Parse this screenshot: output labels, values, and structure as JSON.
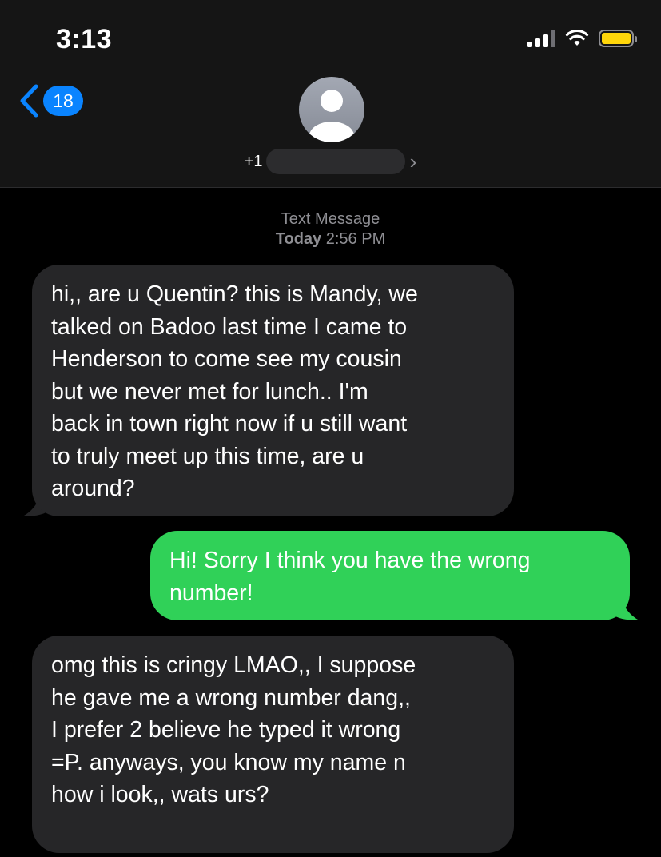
{
  "status_bar": {
    "time": "3:13",
    "battery_color": "#ffd60a"
  },
  "header": {
    "back_icon": "chevron-left-icon",
    "unread_count": "18",
    "contact_prefix": "+1",
    "contact_number_redacted": true,
    "avatar_icon": "person-icon",
    "chevron_icon": "chevron-right-icon"
  },
  "conversation": {
    "service_label": "Text Message",
    "day_label": "Today",
    "time_label": "2:56 PM",
    "messages": [
      {
        "direction": "incoming",
        "lines": [
          "hi,, are u Quentin? this is Mandy, we",
          "talked on Badoo last time I came to",
          "Henderson to come see my cousin",
          "but we never met for lunch.. I'm",
          "back in town right now if u still want",
          "to truly meet up this time, are u",
          "around?"
        ]
      },
      {
        "direction": "outgoing",
        "lines": [
          "Hi! Sorry I think you have the wrong",
          "number!"
        ]
      },
      {
        "direction": "incoming",
        "lines": [
          "omg this is cringy LMAO,, I suppose",
          "he gave me a wrong number dang,,",
          "I prefer 2 believe he typed it wrong",
          "=P. anyways, you know my name n",
          "how i look,, wats urs?"
        ]
      }
    ]
  },
  "colors": {
    "incoming_bubble": "#262628",
    "outgoing_bubble": "#30d158",
    "accent": "#0a84ff"
  }
}
